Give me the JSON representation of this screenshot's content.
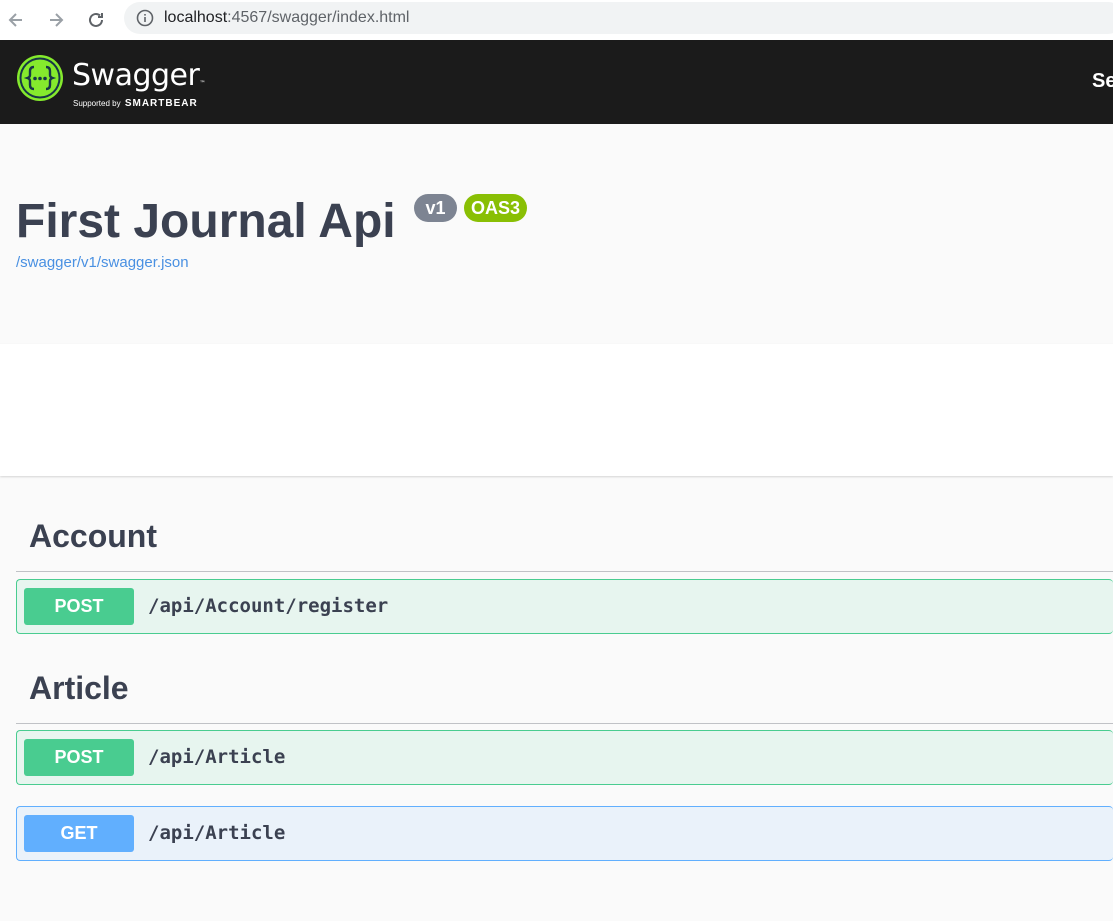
{
  "browser": {
    "url_host": "localhost",
    "url_rest": ":4567/swagger/index.html"
  },
  "topbar": {
    "logo_title": "Swagger",
    "logo_tm": "™",
    "logo_supported": "Supported by",
    "logo_brand": "SMARTBEAR",
    "right_text": "Se"
  },
  "info": {
    "title": "First Journal Api",
    "version_badge": "v1",
    "oas_badge": "OAS3",
    "spec_link": "/swagger/v1/swagger.json"
  },
  "tags": [
    {
      "name": "Account",
      "operations": [
        {
          "method": "POST",
          "path": "/api/Account/register"
        }
      ]
    },
    {
      "name": "Article",
      "operations": [
        {
          "method": "POST",
          "path": "/api/Article"
        },
        {
          "method": "GET",
          "path": "/api/Article"
        }
      ]
    }
  ],
  "colors": {
    "post": "#49cc90",
    "get": "#61affe",
    "topbar": "#1b1b1b",
    "swagger_green": "#85ea2d",
    "oas_badge": "#89bf04",
    "version_badge": "#7d8492"
  },
  "icons": {
    "back": "arrow-left-icon",
    "forward": "arrow-right-icon",
    "reload": "reload-icon",
    "info": "info-circle-icon",
    "logo": "swagger-logo-icon"
  }
}
